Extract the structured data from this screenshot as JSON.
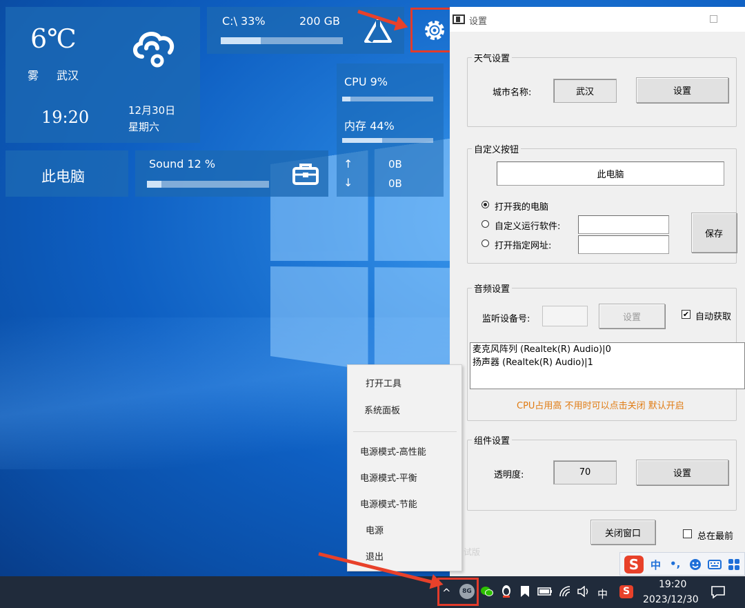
{
  "widget": {
    "temperature": "6℃",
    "weather": "雾",
    "city": "武汉",
    "time": "19:20",
    "date": "12月30日",
    "weekday": "星期六",
    "disk_label": "C:\\ 33%",
    "disk_size": "200 GB",
    "disk_usage": 0.33,
    "cpu_label": "CPU 9%",
    "cpu_usage": 0.09,
    "mem_label": "内存 44%",
    "mem_usage": 0.44,
    "net_up_arrow": "↑",
    "net_down_arrow": "↓",
    "net_up": "0B",
    "net_down": "0B",
    "pc_button": "此电脑",
    "sound_label": "Sound  12 %",
    "sound_level": 0.12
  },
  "settings": {
    "title": "设置",
    "weather_group": {
      "legend": "天气设置",
      "city_label": "城市名称:",
      "city_value": "武汉",
      "set_button": "设置"
    },
    "custom_group": {
      "legend": "自定义按钮",
      "button_name": "此电脑",
      "opt_open_pc": "打开我的电脑",
      "opt_run_software": "自定义运行软件:",
      "opt_open_url": "打开指定网址:",
      "save_button": "保存",
      "run_software_value": "",
      "url_value": ""
    },
    "audio_group": {
      "legend": "音频设置",
      "device_label": "监听设备号:",
      "device_value": "",
      "set_button": "设置",
      "auto_label": "自动获取",
      "devices": [
        "麦克风阵列 (Realtek(R) Audio)|0",
        "扬声器 (Realtek(R) Audio)|1"
      ],
      "warning": "CPU占用高  不用时可以点击关闭  默认开启"
    },
    "component_group": {
      "legend": "组件设置",
      "opacity_label": "透明度:",
      "opacity_value": "70",
      "set_button": "设置"
    },
    "close_button": "关闭窗口",
    "always_top_label": "总在最前",
    "faint_text": "试版"
  },
  "context_menu": {
    "items": [
      "打开工具",
      "系统面板",
      "电源模式-高性能",
      "电源模式-平衡",
      "电源模式-节能",
      "电源",
      "退出"
    ]
  },
  "ime": {
    "mode": "中",
    "punct": "•,",
    "logo": "S"
  },
  "taskbar": {
    "tray_up": "^",
    "tray_app": "8G",
    "lang": "中",
    "clock_time": "19:20",
    "clock_date": "2023/12/30"
  },
  "colors": {
    "accent_red": "#e23b2b",
    "warning_orange": "#e07b12",
    "tile_blue": "#1c69b4"
  }
}
